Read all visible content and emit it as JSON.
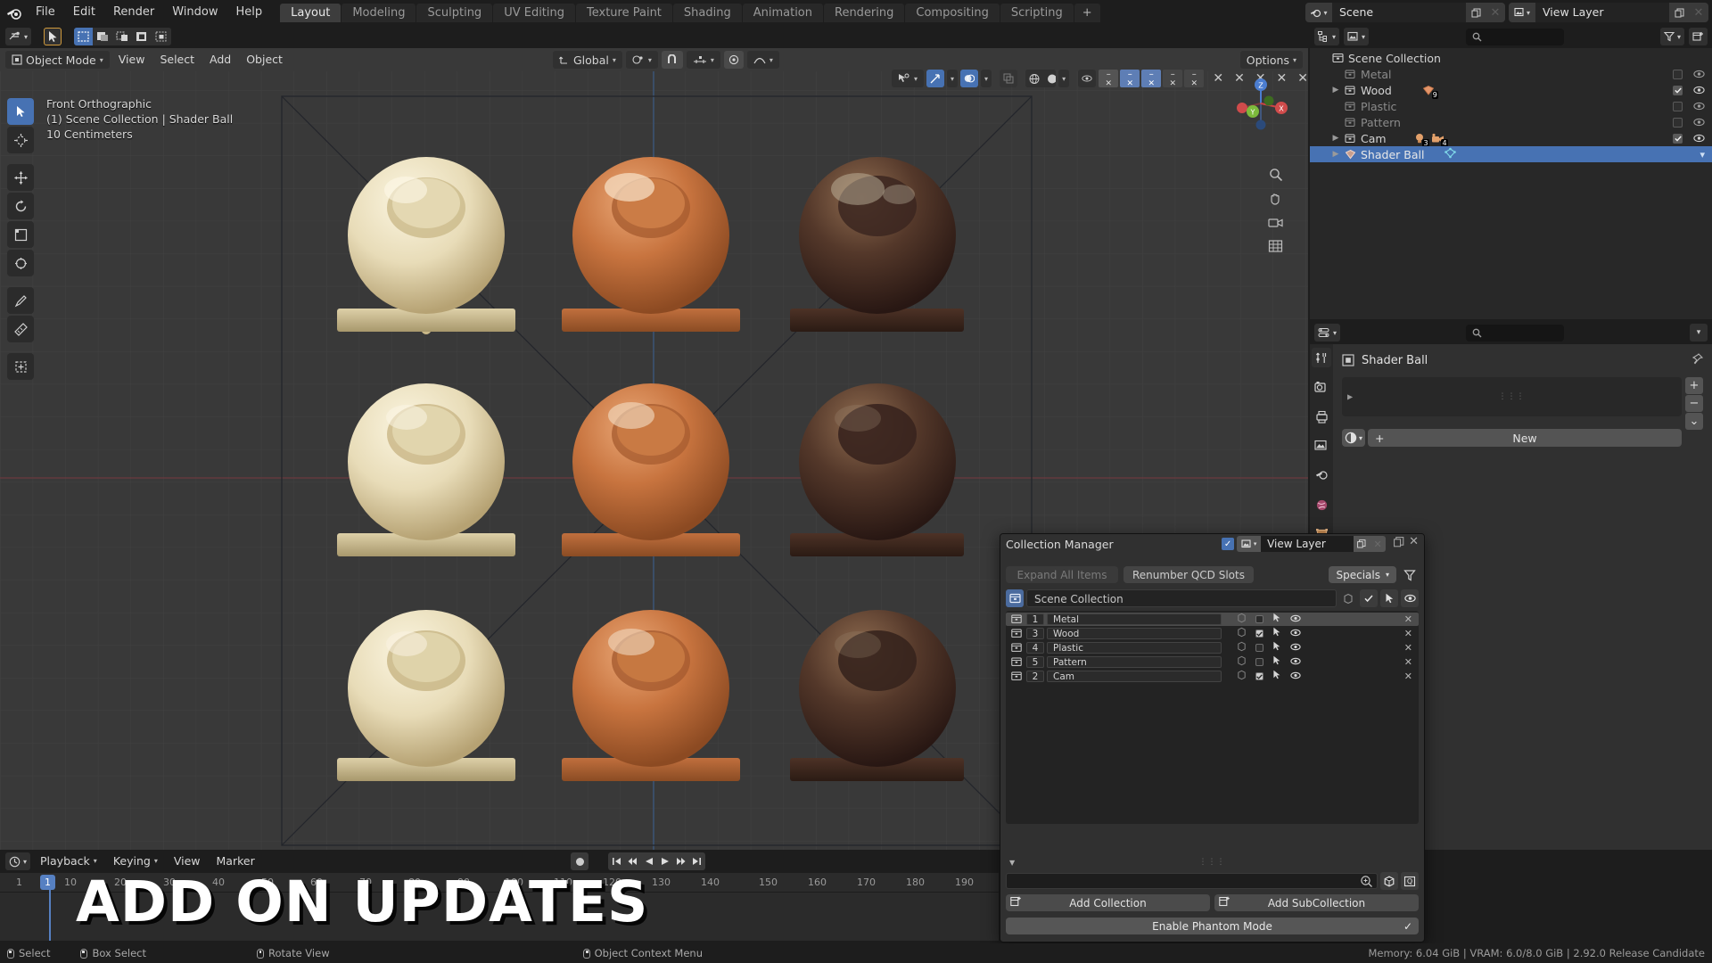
{
  "app": {
    "menus": [
      "File",
      "Edit",
      "Render",
      "Window",
      "Help"
    ],
    "workspace_tabs": [
      {
        "label": "Layout",
        "active": true
      },
      {
        "label": "Modeling",
        "active": false
      },
      {
        "label": "Sculpting",
        "active": false
      },
      {
        "label": "UV Editing",
        "active": false
      },
      {
        "label": "Texture Paint",
        "active": false
      },
      {
        "label": "Shading",
        "active": false
      },
      {
        "label": "Animation",
        "active": false
      },
      {
        "label": "Rendering",
        "active": false
      },
      {
        "label": "Compositing",
        "active": false
      },
      {
        "label": "Scripting",
        "active": false
      },
      {
        "label": "+",
        "active": false
      }
    ],
    "scene_name": "Scene",
    "view_layer_name": "View Layer"
  },
  "viewport": {
    "mode": "Object Mode",
    "menus": [
      "View",
      "Select",
      "Add",
      "Object"
    ],
    "transform_orientation": "Global",
    "options_label": "Options",
    "overlay_line1": "Front Orthographic",
    "overlay_line2": "(1) Scene Collection | Shader Ball",
    "overlay_line3": "10 Centimeters",
    "gizmo_axes": {
      "x": "X",
      "y": "Y",
      "z": "Z"
    }
  },
  "timeline": {
    "menus": [
      "Playback",
      "Keying",
      "View",
      "Marker"
    ],
    "current_frame": "1",
    "ticks": [
      "1",
      "10",
      "20",
      "30",
      "40",
      "50",
      "60",
      "70",
      "80",
      "90",
      "100",
      "110",
      "120",
      "130",
      "140",
      "150",
      "160",
      "170",
      "180",
      "190"
    ]
  },
  "overlay_banner": "ADD ON UPDATES",
  "outliner": {
    "search_placeholder": "",
    "root": "Scene Collection",
    "rows": [
      {
        "label": "Metal",
        "dim": true,
        "expandable": false,
        "checked": false,
        "visible": true,
        "selected": false,
        "badges": []
      },
      {
        "label": "Wood",
        "dim": false,
        "expandable": true,
        "checked": true,
        "visible": true,
        "selected": false,
        "badges": [
          {
            "icon": "mesh-data-icon",
            "count": "9"
          }
        ]
      },
      {
        "label": "Plastic",
        "dim": true,
        "expandable": false,
        "checked": false,
        "visible": true,
        "selected": false,
        "badges": []
      },
      {
        "label": "Pattern",
        "dim": true,
        "expandable": false,
        "checked": false,
        "visible": true,
        "selected": false,
        "badges": []
      },
      {
        "label": "Cam",
        "dim": false,
        "expandable": true,
        "checked": true,
        "visible": true,
        "selected": false,
        "badges": [
          {
            "icon": "light-icon",
            "count": "3"
          },
          {
            "icon": "camera-icon",
            "count": "4"
          }
        ]
      },
      {
        "label": "Shader Ball",
        "dim": false,
        "expandable": true,
        "checked": null,
        "visible": true,
        "selected": true,
        "badges": [
          {
            "icon": "mesh-data-icon",
            "count": ""
          }
        ]
      }
    ]
  },
  "properties": {
    "object_name": "Shader Ball",
    "new_material_label": "New",
    "tabs": [
      "tool-icon",
      "render-icon",
      "output-icon",
      "view-layer-icon",
      "scene-icon",
      "world-icon",
      "object-icon",
      "modifier-icon",
      "material-icon"
    ],
    "slot_buttons": [
      "+",
      "−",
      "⌄"
    ]
  },
  "collection_manager": {
    "title": "Collection Manager",
    "view_layer_name": "View Layer",
    "expand_all_label": "Expand All Items",
    "renumber_label": "Renumber QCD Slots",
    "specials_label": "Specials",
    "scene_collection_label": "Scene Collection",
    "add_collection_label": "Add Collection",
    "add_subcollection_label": "Add SubCollection",
    "phantom_mode_label": "Enable Phantom Mode",
    "search_value": "",
    "rows": [
      {
        "qcd": "1",
        "name": "Metal",
        "exclude": false,
        "selected": true,
        "holdout": false,
        "visible": true
      },
      {
        "qcd": "3",
        "name": "Wood",
        "exclude": true,
        "selected": false,
        "holdout": false,
        "visible": true
      },
      {
        "qcd": "4",
        "name": "Plastic",
        "exclude": false,
        "selected": false,
        "holdout": false,
        "visible": true
      },
      {
        "qcd": "5",
        "name": "Pattern",
        "exclude": false,
        "selected": false,
        "holdout": false,
        "visible": true
      },
      {
        "qcd": "2",
        "name": "Cam",
        "exclude": true,
        "selected": false,
        "holdout": false,
        "visible": true
      }
    ]
  },
  "statusbar": {
    "items": [
      {
        "mouse": "l",
        "label": "Select"
      },
      {
        "mouse": "l2",
        "label": "Box Select"
      },
      {
        "mouse": "m",
        "label": "Rotate View"
      },
      {
        "mouse": "r",
        "label": "Object Context Menu"
      }
    ],
    "info": "Memory: 6.04 GiB | VRAM: 6.0/8.0 GiB | 2.92.0 Release Candidate"
  },
  "colors": {
    "accent_blue": "#4772b3",
    "panel_bg": "#303030",
    "header_bg": "#1d1d1d",
    "viewport_bg": "#393939",
    "axis_x": "#cc3b3b",
    "axis_y": "#7dbb3b",
    "axis_z": "#3b79cc"
  },
  "shader_balls": [
    {
      "row": 0,
      "col": 0,
      "base": "#e8dcb8",
      "shade": "#c4b183",
      "hl": "#fbf5e0"
    },
    {
      "row": 0,
      "col": 1,
      "base": "#c8743f",
      "shade": "#9a5227",
      "hl": "#e9a877"
    },
    {
      "row": 0,
      "col": 2,
      "base": "#54382a",
      "shade": "#33201a",
      "hl": "#8f6c50"
    },
    {
      "row": 1,
      "col": 0,
      "base": "#e6dbb4",
      "shade": "#c0ad7e",
      "hl": "#f7f0dc"
    },
    {
      "row": 1,
      "col": 1,
      "base": "#c6733f",
      "shade": "#9c5329",
      "hl": "#e3a273"
    },
    {
      "row": 1,
      "col": 2,
      "base": "#4e3326",
      "shade": "#2e1d16",
      "hl": "#7d5c43"
    },
    {
      "row": 2,
      "col": 0,
      "base": "#e4d8b0",
      "shade": "#bba97b",
      "hl": "#f5eed8"
    },
    {
      "row": 2,
      "col": 1,
      "base": "#c3703d",
      "shade": "#985026",
      "hl": "#e09f70"
    },
    {
      "row": 2,
      "col": 2,
      "base": "#4b3125",
      "shade": "#2c1c15",
      "hl": "#7a5940"
    }
  ]
}
